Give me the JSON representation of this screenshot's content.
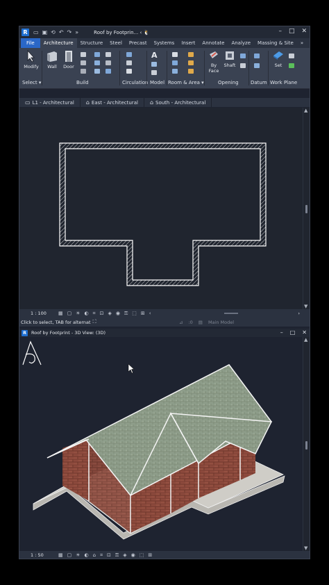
{
  "window": {
    "app_icon": "R",
    "title": "Roof by Footprin... ‹  🐧",
    "controls": [
      "–",
      "□",
      "✕"
    ]
  },
  "quick_access": [
    "folder-icon",
    "save-icon",
    "sync-icon",
    "undo-icon",
    "redo-icon",
    "more-icon"
  ],
  "tabs": [
    "File",
    "Architecture",
    "Structure",
    "Steel",
    "Precast",
    "Systems",
    "Insert",
    "Annotate",
    "Analyze",
    "Massing & Site",
    "»"
  ],
  "active_tab": "Architecture",
  "ribbon": {
    "modify": "Modify",
    "wall": "Wall",
    "door": "Door",
    "by_face": "By\nFace",
    "by_face_l1": "By",
    "by_face_l2": "Face",
    "shaft": "Shaft",
    "set": "Set",
    "panels": {
      "select": "Select ▾",
      "build": "Build",
      "circulation": "Circulation",
      "model": "Model",
      "room_area": "Room & Area ▾",
      "opening": "Opening",
      "datum": "Datum",
      "work_plane": "Work Plane"
    }
  },
  "view_tabs": [
    "L1 - Architectural",
    "East - Architectural",
    "South - Architectural"
  ],
  "plan_view": {
    "scale": "1 : 100"
  },
  "status": {
    "text": "Click to select, TAB for alternat",
    "count": ":0",
    "model": "Main Model"
  },
  "view3d": {
    "title": "Roof by Footprint - 3D View: (3D)",
    "scale": "1 : 50",
    "controls": [
      "–",
      "□",
      "✕"
    ]
  },
  "colors": {
    "accent": "#2a67c7",
    "roof": "#8a9a86",
    "brick": "#8a4a3e",
    "slab": "#c8c6c0"
  }
}
